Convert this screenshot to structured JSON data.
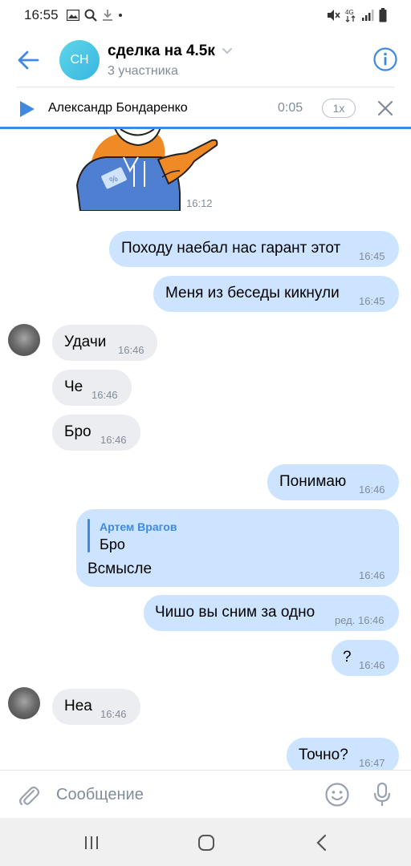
{
  "status_bar": {
    "time": "16:55"
  },
  "header": {
    "avatar_initials": "СН",
    "title": "сделка на 4.5к",
    "subtitle": "3 участника"
  },
  "audio": {
    "name": "Александр Бондаренко",
    "time": "0:05",
    "speed": "1x"
  },
  "sticker": {
    "time": "16:12"
  },
  "messages": [
    {
      "dir": "out",
      "text": "Походу наебал нас гарант этот",
      "time": "16:45"
    },
    {
      "dir": "out",
      "text": "Меня из беседы кикнули",
      "time": "16:45"
    },
    {
      "dir": "in",
      "text": "Удачи",
      "time": "16:46"
    },
    {
      "dir": "in",
      "text": "Че",
      "time": "16:46"
    },
    {
      "dir": "in",
      "text": "Бро",
      "time": "16:46"
    },
    {
      "dir": "out",
      "text": "Понимаю",
      "time": "16:46"
    },
    {
      "dir": "out",
      "reply_author": "Артем Врагов",
      "reply_text": "Бро",
      "text": "Всмысле",
      "time": "16:46"
    },
    {
      "dir": "out",
      "text": "Чишо вы сним за одно",
      "time": "ред. 16:46"
    },
    {
      "dir": "out",
      "text": "?",
      "time": "16:46"
    },
    {
      "dir": "in",
      "text": "Неа",
      "time": "16:46"
    },
    {
      "dir": "out",
      "text": "Точно?",
      "time": "16:47"
    }
  ],
  "input": {
    "placeholder": "Сообщение"
  },
  "colors": {
    "accent": "#3f8ae0",
    "bubble_out": "#cce4ff",
    "bubble_in": "#ebedf0"
  }
}
